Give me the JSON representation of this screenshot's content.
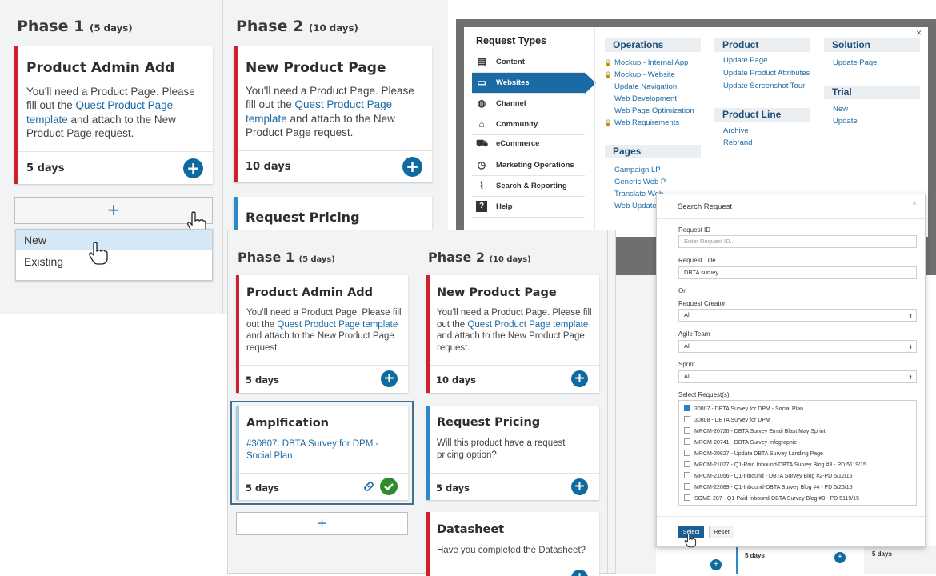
{
  "board1": {
    "phase1": {
      "title": "Phase 1",
      "duration": "(5 days)"
    },
    "phase2": {
      "title": "Phase 2",
      "duration": "(10 days)"
    },
    "card_product_admin": {
      "title": "Product Admin Add",
      "desc_before": "You'll need a Product Page. Please fill out the ",
      "link": "Quest Product Page template",
      "desc_after": " and attach to the New Product Page request.",
      "days": "5 days"
    },
    "card_new_product": {
      "title": "New Product Page",
      "desc_before": "You'll need a Product Page. Please fill out the ",
      "link": "Quest Product Page template",
      "desc_after": " and attach to the New Product Page request.",
      "days": "10 days"
    },
    "card_request_pricing_title": "Request Pricing",
    "add_label": "+",
    "dropdown": [
      "New",
      "Existing"
    ]
  },
  "request_types": {
    "heading": "Request Types",
    "close": "×",
    "items": [
      {
        "label": "Content",
        "icon": "content-icon"
      },
      {
        "label": "Websites",
        "icon": "websites-icon"
      },
      {
        "label": "Channel",
        "icon": "channel-icon"
      },
      {
        "label": "Community",
        "icon": "community-icon"
      },
      {
        "label": "eCommerce",
        "icon": "cart-icon"
      },
      {
        "label": "Marketing Operations",
        "icon": "clock-icon"
      },
      {
        "label": "Search & Reporting",
        "icon": "chart-icon"
      },
      {
        "label": "Help",
        "icon": "help-icon"
      }
    ],
    "operations": {
      "heading": "Operations",
      "links": [
        "Mockup - Internal App",
        "Mockup - Website",
        "Update Navigation",
        "Web Development",
        "Web Page Optimization",
        "Web Requirements"
      ]
    },
    "pages": {
      "heading": "Pages",
      "links": [
        "Campaign LP",
        "Generic Web P",
        "Translate Web",
        "Web Update (n"
      ]
    },
    "product": {
      "heading": "Product",
      "links": [
        "Update Page",
        "Update Product Attributes",
        "Update Screenshot Tour"
      ]
    },
    "product_line": {
      "heading": "Product Line",
      "links": [
        "Archive",
        "Rebrand"
      ]
    },
    "solution": {
      "heading": "Solution",
      "links": [
        "Update Page"
      ]
    },
    "trial": {
      "heading": "Trial",
      "links": [
        "New",
        "Update"
      ]
    }
  },
  "board2": {
    "phase1": {
      "title": "Phase 1",
      "duration": "(5 days)"
    },
    "phase2": {
      "title": "Phase 2",
      "duration": "(10 days)"
    },
    "card_product_admin": {
      "title": "Product Admin Add",
      "desc_before": "You'll need a Product Page. Please fill out the ",
      "link": "Quest Product Page template",
      "desc_after": " and attach to the New Product Page request.",
      "days": "5 days"
    },
    "card_amplification": {
      "title": "Amplfication",
      "link": "#30807: DBTA Survey for DPM - Social Plan",
      "days": "5 days"
    },
    "card_new_product": {
      "title": "New Product Page",
      "desc_before": "You'll need a Product Page. Please fill out the ",
      "link": "Quest Product Page template",
      "desc_after": " and attach to the New Product Page request.",
      "days": "10 days"
    },
    "card_request_pricing": {
      "title": "Request Pricing",
      "desc": "Will this product have a request pricing option?",
      "days": "5 days"
    },
    "card_datasheet": {
      "title": "Datasheet",
      "desc": "Have you completed the Datasheet?"
    },
    "add_label": "+"
  },
  "search_request": {
    "title": "Search Request",
    "close": "×",
    "request_id_label": "Request ID",
    "request_id_placeholder": "Enter Request ID...",
    "request_title_label": "Request Title",
    "request_title_value": "DBTA survey",
    "or_label": "Or",
    "creator_label": "Request Creator",
    "creator_value": "All",
    "agile_team_label": "Agile Team",
    "agile_team_value": "All",
    "sprint_label": "Sprint",
    "sprint_value": "All",
    "select_requests_label": "Select Request(s)",
    "requests": [
      {
        "label": "30807 - DBTA Survey for DPM - Social Plan",
        "checked": true
      },
      {
        "label": "30808 - DBTA Survey for DPM",
        "checked": false
      },
      {
        "label": "MRCM-20726 - DBTA Survey Email Blast May Sprint",
        "checked": false
      },
      {
        "label": "MRCM-20741 - DBTA Survey Infographic",
        "checked": false
      },
      {
        "label": "MRCM-20827 - Update DBTA Survey Landing Page",
        "checked": false
      },
      {
        "label": "MRCM-21027 - Q1-Paid Inbound-DBTA Survey Blog #3 - PD 5119/15",
        "checked": false
      },
      {
        "label": "MRCM-21056 - Q1-Inbound - DBTA Survey Blog #2-PD 5/12/15",
        "checked": false
      },
      {
        "label": "MRCM-22089 - Q1-Inbound-DBTA Survey Blog #4 - PD 5/26/15",
        "checked": false
      },
      {
        "label": "SOME-287 - Q1-Paid Inbound-DBTA Survey Blog #3 - PD 5119/15",
        "checked": false
      }
    ],
    "select_button": "Select",
    "reset_button": "Reset"
  },
  "background_fragments": {
    "days_a": "5 days",
    "days_b": "5 days"
  },
  "colors": {
    "accent_blue": "#0f6aa0",
    "link_blue": "#1a6aa5",
    "phase_red": "#d0202e",
    "check_green": "#2e8b2e"
  }
}
